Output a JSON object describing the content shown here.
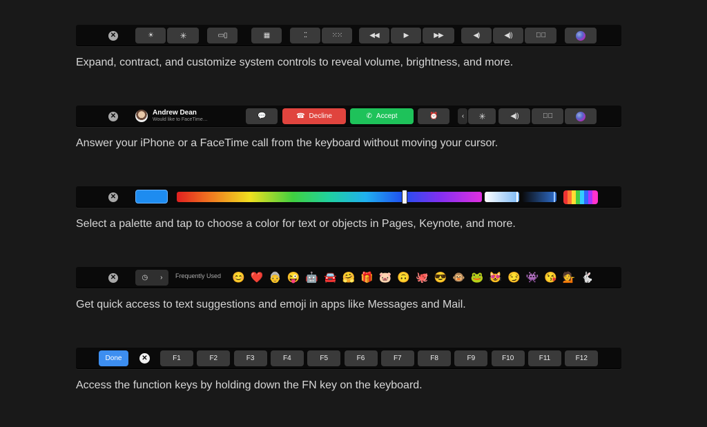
{
  "rows": [
    {
      "caption": "Expand, contract, and customize system controls to reveal volume, brightness, and more."
    },
    {
      "caption": "Answer your iPhone or a FaceTime call from the keyboard without moving your cursor."
    },
    {
      "caption": "Select a palette and tap to choose a color for text or objects in Pages, Keynote, and more."
    },
    {
      "caption": "Get quick access to text suggestions and emoji in apps like Messages and Mail."
    },
    {
      "caption": "Access the function keys by holding down the FN key on the keyboard."
    }
  ],
  "call": {
    "name": "Andrew Dean",
    "subtitle": "Would like to FaceTime…",
    "decline_label": "Decline",
    "accept_label": "Accept",
    "decline_color": "#e0443e",
    "accept_color": "#1ec25a"
  },
  "emoji_bar": {
    "category_label": "Frequently Used",
    "emojis": [
      "😊",
      "❤️",
      "👵",
      "😜",
      "🤖",
      "🚘",
      "🤗",
      "🎁",
      "🐷",
      "🙃",
      "🐙",
      "😎",
      "🐵",
      "🐸",
      "😻",
      "😏",
      "👾",
      "😘",
      "💁",
      "🐇"
    ]
  },
  "fn_bar": {
    "done_label": "Done",
    "done_color": "#3d8ef0",
    "keys": [
      "F1",
      "F2",
      "F3",
      "F4",
      "F5",
      "F6",
      "F7",
      "F8",
      "F9",
      "F10",
      "F11",
      "F12"
    ]
  },
  "color_bar": {
    "selected_swatch": "#1e8cf0"
  }
}
